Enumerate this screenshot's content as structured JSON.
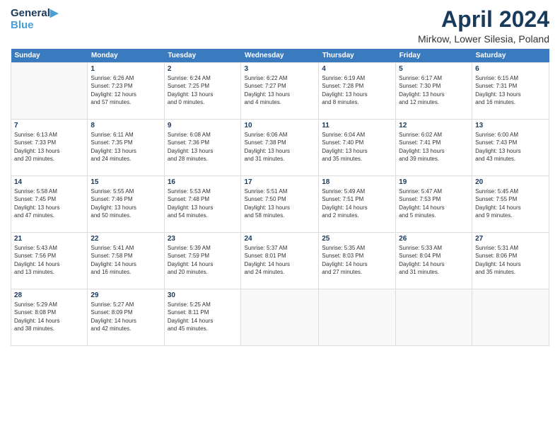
{
  "logo": {
    "line1": "General",
    "line2": "Blue"
  },
  "title": "April 2024",
  "location": "Mirkow, Lower Silesia, Poland",
  "days_header": [
    "Sunday",
    "Monday",
    "Tuesday",
    "Wednesday",
    "Thursday",
    "Friday",
    "Saturday"
  ],
  "weeks": [
    [
      {
        "day": "",
        "info": ""
      },
      {
        "day": "1",
        "info": "Sunrise: 6:26 AM\nSunset: 7:23 PM\nDaylight: 12 hours\nand 57 minutes."
      },
      {
        "day": "2",
        "info": "Sunrise: 6:24 AM\nSunset: 7:25 PM\nDaylight: 13 hours\nand 0 minutes."
      },
      {
        "day": "3",
        "info": "Sunrise: 6:22 AM\nSunset: 7:27 PM\nDaylight: 13 hours\nand 4 minutes."
      },
      {
        "day": "4",
        "info": "Sunrise: 6:19 AM\nSunset: 7:28 PM\nDaylight: 13 hours\nand 8 minutes."
      },
      {
        "day": "5",
        "info": "Sunrise: 6:17 AM\nSunset: 7:30 PM\nDaylight: 13 hours\nand 12 minutes."
      },
      {
        "day": "6",
        "info": "Sunrise: 6:15 AM\nSunset: 7:31 PM\nDaylight: 13 hours\nand 16 minutes."
      }
    ],
    [
      {
        "day": "7",
        "info": "Sunrise: 6:13 AM\nSunset: 7:33 PM\nDaylight: 13 hours\nand 20 minutes."
      },
      {
        "day": "8",
        "info": "Sunrise: 6:11 AM\nSunset: 7:35 PM\nDaylight: 13 hours\nand 24 minutes."
      },
      {
        "day": "9",
        "info": "Sunrise: 6:08 AM\nSunset: 7:36 PM\nDaylight: 13 hours\nand 28 minutes."
      },
      {
        "day": "10",
        "info": "Sunrise: 6:06 AM\nSunset: 7:38 PM\nDaylight: 13 hours\nand 31 minutes."
      },
      {
        "day": "11",
        "info": "Sunrise: 6:04 AM\nSunset: 7:40 PM\nDaylight: 13 hours\nand 35 minutes."
      },
      {
        "day": "12",
        "info": "Sunrise: 6:02 AM\nSunset: 7:41 PM\nDaylight: 13 hours\nand 39 minutes."
      },
      {
        "day": "13",
        "info": "Sunrise: 6:00 AM\nSunset: 7:43 PM\nDaylight: 13 hours\nand 43 minutes."
      }
    ],
    [
      {
        "day": "14",
        "info": "Sunrise: 5:58 AM\nSunset: 7:45 PM\nDaylight: 13 hours\nand 47 minutes."
      },
      {
        "day": "15",
        "info": "Sunrise: 5:55 AM\nSunset: 7:46 PM\nDaylight: 13 hours\nand 50 minutes."
      },
      {
        "day": "16",
        "info": "Sunrise: 5:53 AM\nSunset: 7:48 PM\nDaylight: 13 hours\nand 54 minutes."
      },
      {
        "day": "17",
        "info": "Sunrise: 5:51 AM\nSunset: 7:50 PM\nDaylight: 13 hours\nand 58 minutes."
      },
      {
        "day": "18",
        "info": "Sunrise: 5:49 AM\nSunset: 7:51 PM\nDaylight: 14 hours\nand 2 minutes."
      },
      {
        "day": "19",
        "info": "Sunrise: 5:47 AM\nSunset: 7:53 PM\nDaylight: 14 hours\nand 5 minutes."
      },
      {
        "day": "20",
        "info": "Sunrise: 5:45 AM\nSunset: 7:55 PM\nDaylight: 14 hours\nand 9 minutes."
      }
    ],
    [
      {
        "day": "21",
        "info": "Sunrise: 5:43 AM\nSunset: 7:56 PM\nDaylight: 14 hours\nand 13 minutes."
      },
      {
        "day": "22",
        "info": "Sunrise: 5:41 AM\nSunset: 7:58 PM\nDaylight: 14 hours\nand 16 minutes."
      },
      {
        "day": "23",
        "info": "Sunrise: 5:39 AM\nSunset: 7:59 PM\nDaylight: 14 hours\nand 20 minutes."
      },
      {
        "day": "24",
        "info": "Sunrise: 5:37 AM\nSunset: 8:01 PM\nDaylight: 14 hours\nand 24 minutes."
      },
      {
        "day": "25",
        "info": "Sunrise: 5:35 AM\nSunset: 8:03 PM\nDaylight: 14 hours\nand 27 minutes."
      },
      {
        "day": "26",
        "info": "Sunrise: 5:33 AM\nSunset: 8:04 PM\nDaylight: 14 hours\nand 31 minutes."
      },
      {
        "day": "27",
        "info": "Sunrise: 5:31 AM\nSunset: 8:06 PM\nDaylight: 14 hours\nand 35 minutes."
      }
    ],
    [
      {
        "day": "28",
        "info": "Sunrise: 5:29 AM\nSunset: 8:08 PM\nDaylight: 14 hours\nand 38 minutes."
      },
      {
        "day": "29",
        "info": "Sunrise: 5:27 AM\nSunset: 8:09 PM\nDaylight: 14 hours\nand 42 minutes."
      },
      {
        "day": "30",
        "info": "Sunrise: 5:25 AM\nSunset: 8:11 PM\nDaylight: 14 hours\nand 45 minutes."
      },
      {
        "day": "",
        "info": ""
      },
      {
        "day": "",
        "info": ""
      },
      {
        "day": "",
        "info": ""
      },
      {
        "day": "",
        "info": ""
      }
    ]
  ]
}
